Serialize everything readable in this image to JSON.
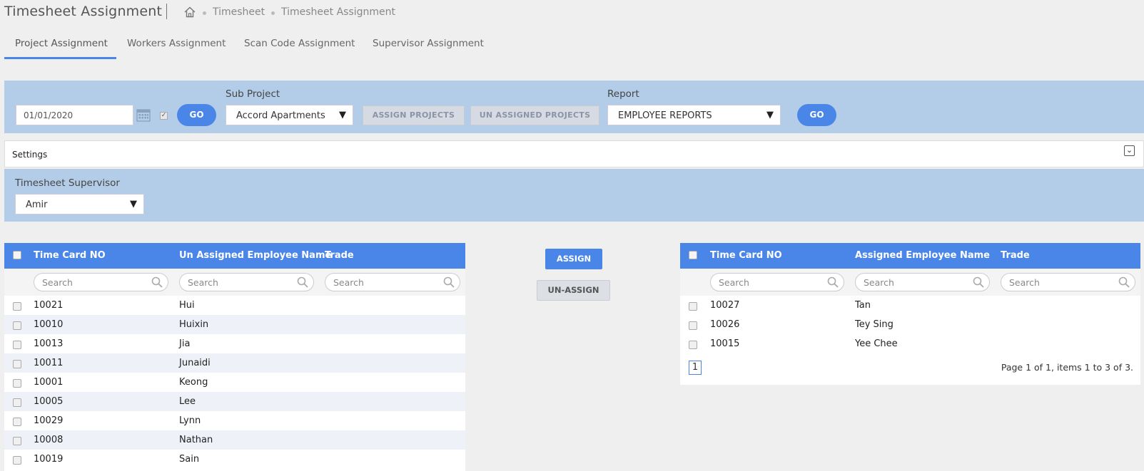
{
  "header": {
    "title": "Timesheet Assignment",
    "breadcrumb": [
      "Timesheet",
      "Timesheet Assignment"
    ]
  },
  "tabs": [
    {
      "label": "Project Assignment",
      "active": true
    },
    {
      "label": "Workers Assignment",
      "active": false
    },
    {
      "label": "Scan Code Assignment",
      "active": false
    },
    {
      "label": "Supervisor Assignment",
      "active": false
    }
  ],
  "toolbar": {
    "date_value": "01/01/2020",
    "go_label": "GO",
    "sub_project_label": "Sub Project",
    "sub_project_value": "Accord Apartments",
    "assign_projects_label": "ASSIGN PROJECTS",
    "unassigned_projects_label": "UN ASSIGNED PROJECTS",
    "report_label": "Report",
    "report_value": "EMPLOYEE REPORTS",
    "go2_label": "GO"
  },
  "settings": {
    "label": "Settings",
    "collapse_glyph": "⌄"
  },
  "supervisor": {
    "label": "Timesheet Supervisor",
    "value": "Amir"
  },
  "unassigned_grid": {
    "columns": [
      "Time Card NO",
      "Un Assigned Employee Name",
      "Trade"
    ],
    "search_placeholder": "Search",
    "rows": [
      {
        "card": "10021",
        "name": "Hui",
        "trade": ""
      },
      {
        "card": "10010",
        "name": "Huixin",
        "trade": ""
      },
      {
        "card": "10013",
        "name": "Jia",
        "trade": ""
      },
      {
        "card": "10011",
        "name": "Junaidi",
        "trade": ""
      },
      {
        "card": "10001",
        "name": "Keong",
        "trade": ""
      },
      {
        "card": "10005",
        "name": "Lee",
        "trade": ""
      },
      {
        "card": "10029",
        "name": "Lynn",
        "trade": ""
      },
      {
        "card": "10008",
        "name": "Nathan",
        "trade": ""
      },
      {
        "card": "10019",
        "name": "Sain",
        "trade": ""
      }
    ]
  },
  "actions": {
    "assign_label": "ASSIGN",
    "unassign_label": "UN-ASSIGN"
  },
  "assigned_grid": {
    "columns": [
      "Time Card NO",
      "Assigned Employee Name",
      "Trade"
    ],
    "search_placeholder": "Search",
    "rows": [
      {
        "card": "10027",
        "name": "Tan",
        "trade": ""
      },
      {
        "card": "10026",
        "name": "Tey Sing",
        "trade": ""
      },
      {
        "card": "10015",
        "name": "Yee Chee",
        "trade": ""
      }
    ],
    "pager": {
      "page": "1",
      "info": "Page 1 of 1, items 1 to 3 of 3."
    }
  },
  "colors": {
    "accent": "#4a86e8",
    "panel": "#b3cde8",
    "background": "#efefef"
  }
}
